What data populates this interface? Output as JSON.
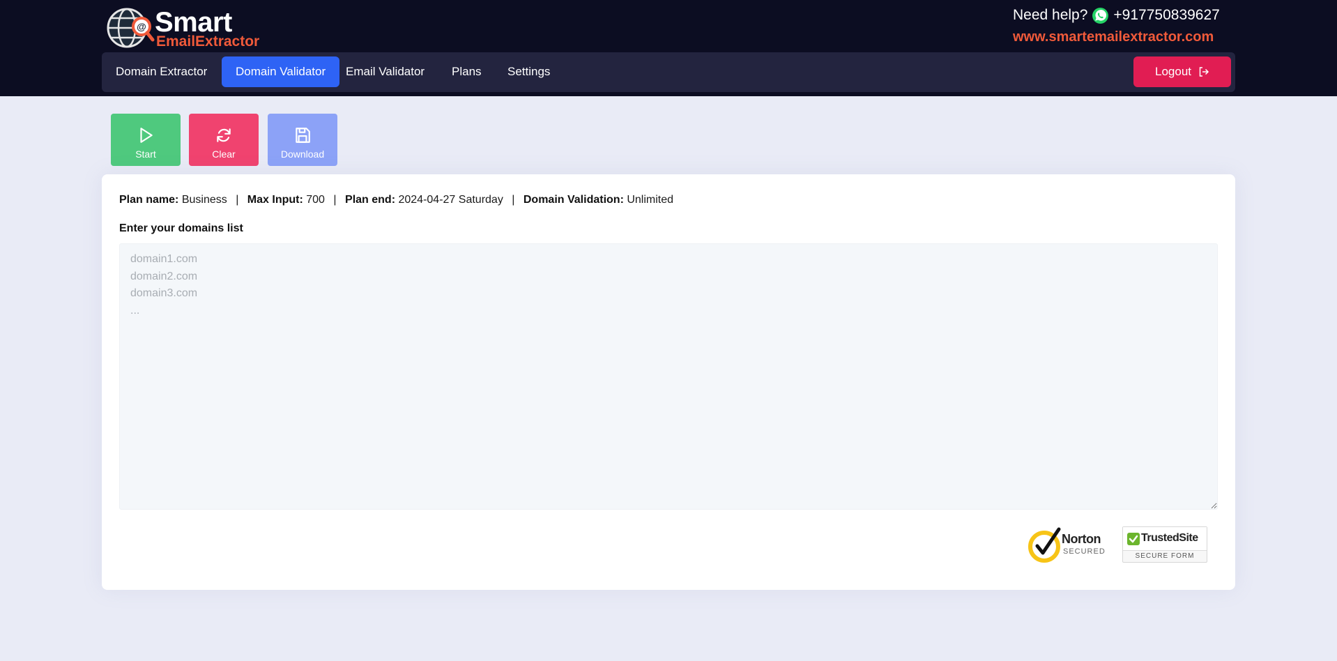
{
  "brand": {
    "logo_main": "Smart",
    "logo_sub": "EmailExtractor",
    "help_label": "Need help?",
    "phone": "+917750839627",
    "website": "www.smartemailextractor.com",
    "accent_color": "#f05a3a"
  },
  "nav": {
    "items": [
      {
        "label": "Domain Extractor",
        "active": false
      },
      {
        "label": "Domain Validator",
        "active": true
      },
      {
        "label": "Email Validator",
        "active": false
      },
      {
        "label": "Plans",
        "active": false
      },
      {
        "label": "Settings",
        "active": false
      }
    ],
    "logout_label": "Logout",
    "active_color": "#2e63f5",
    "logout_color": "#e11d53"
  },
  "actions": {
    "start_label": "Start",
    "clear_label": "Clear",
    "download_label": "Download",
    "start_color": "#4fc97e",
    "clear_color": "#f0436f",
    "download_color": "#8ca2f7"
  },
  "plan": {
    "name_label": "Plan name:",
    "name_value": "Business",
    "max_input_label": "Max Input:",
    "max_input_value": "700",
    "plan_end_label": "Plan end:",
    "plan_end_value": "2024-04-27 Saturday",
    "validation_label": "Domain Validation:",
    "validation_value": "Unlimited",
    "separator": "|"
  },
  "domains": {
    "label": "Enter your domains list",
    "value": "",
    "placeholder": "domain1.com\ndomain2.com\ndomain3.com\n..."
  },
  "badges": {
    "norton_name": "Norton",
    "norton_sub": "SECURED",
    "trusted_name": "TrustedSite",
    "trusted_sub": "SECURE FORM"
  }
}
